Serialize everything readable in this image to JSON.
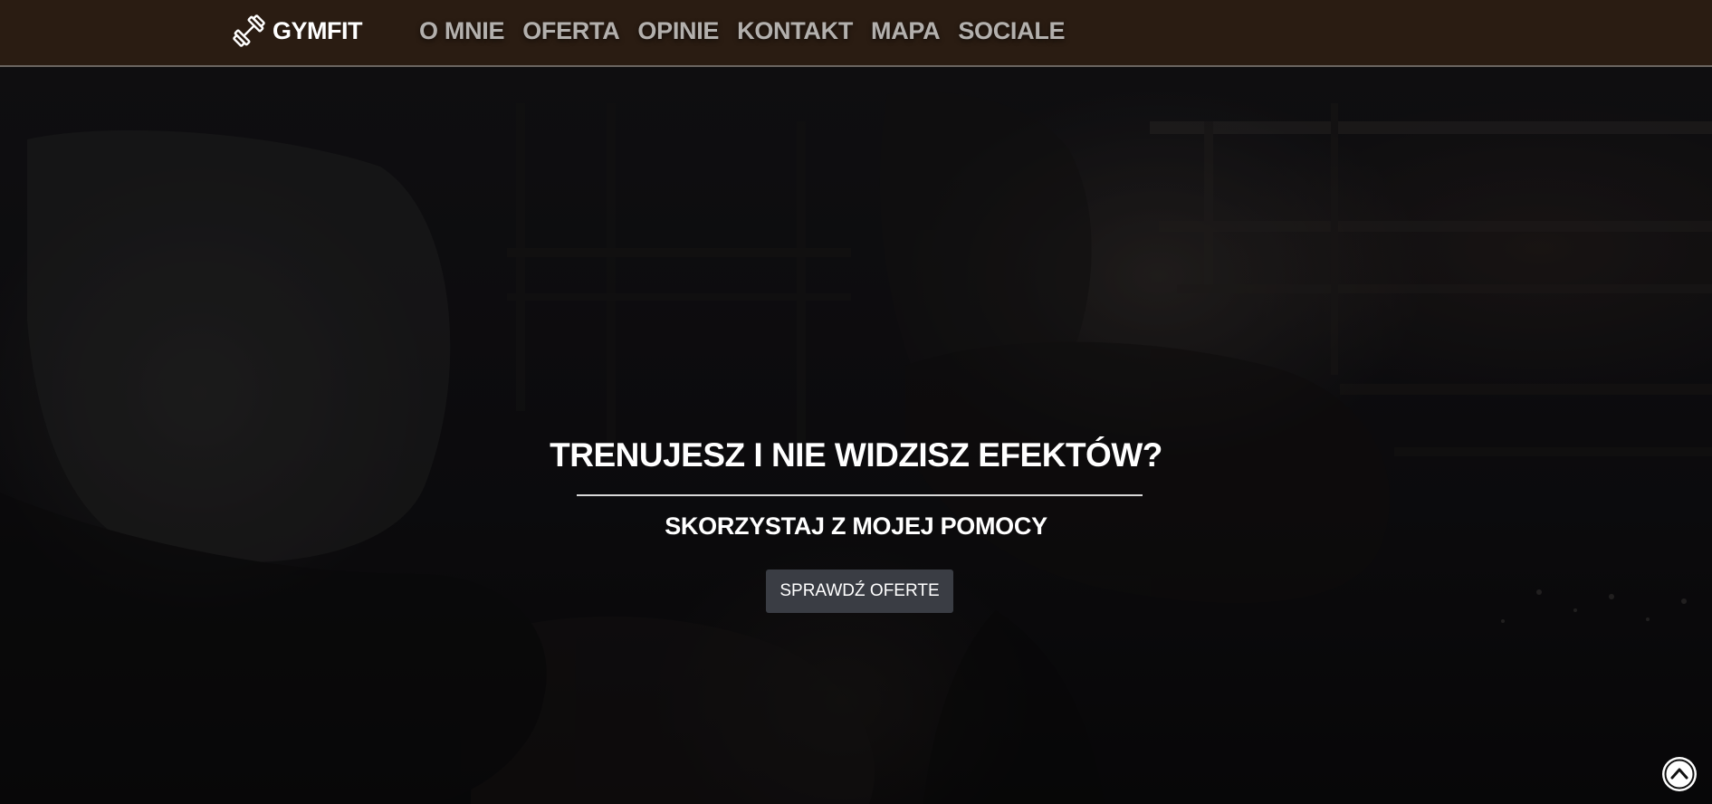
{
  "navbar": {
    "brand": {
      "icon": "dumbbell-icon",
      "name": "GYMFIT"
    },
    "links": [
      {
        "label": "O MNIE"
      },
      {
        "label": "OFERTA"
      },
      {
        "label": "OPINIE"
      },
      {
        "label": "KONTAKT"
      },
      {
        "label": "MAPA"
      },
      {
        "label": "SOCIALE"
      }
    ]
  },
  "hero": {
    "headline": "TRENUJESZ I NIE WIDZISZ EFEKTÓW?",
    "subheadline": "SKORZYSTAJ Z MOJEJ POMOCY",
    "cta_label": "SPRAWDŹ OFERTE"
  },
  "scroll_top": {
    "icon": "chevron-up-icon"
  },
  "colors": {
    "navbar_bg": "#2a1c12",
    "nav_link": "#b3b0ad",
    "button_bg": "#3a3d44",
    "text": "#ffffff"
  }
}
